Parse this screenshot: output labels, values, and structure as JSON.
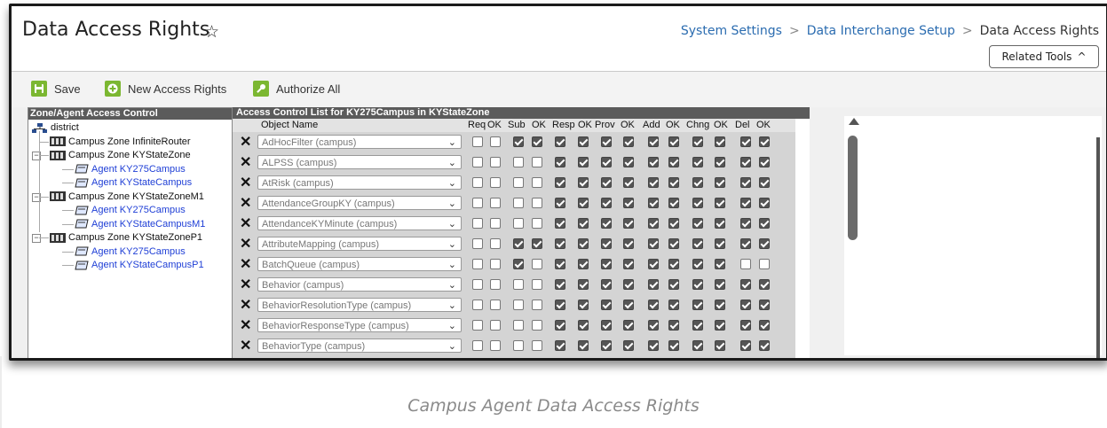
{
  "page": {
    "title": "Data Access Rights",
    "breadcrumb": [
      "System Settings",
      "Data Interchange Setup",
      "Data Access Rights"
    ],
    "related_tools_label": "Related Tools"
  },
  "toolbar": {
    "save_label": "Save",
    "new_label": "New Access Rights",
    "authorize_label": "Authorize All"
  },
  "zone_panel": {
    "title": "Zone/Agent Access Control",
    "nodes": [
      {
        "label": "district",
        "type": "root"
      },
      {
        "label": "Campus Zone InfiniteRouter",
        "type": "zone"
      },
      {
        "label": "Campus Zone KYStateZone",
        "type": "zone"
      },
      {
        "label": "Agent KY275Campus",
        "type": "agent"
      },
      {
        "label": "Agent KYStateCampus",
        "type": "agent"
      },
      {
        "label": "Campus Zone KYStateZoneM1",
        "type": "zone"
      },
      {
        "label": "Agent KY275Campus",
        "type": "agent"
      },
      {
        "label": "Agent KYStateCampusM1",
        "type": "agent"
      },
      {
        "label": "Campus Zone KYStateZoneP1",
        "type": "zone"
      },
      {
        "label": "Agent KY275Campus",
        "type": "agent"
      },
      {
        "label": "Agent KYStateCampusP1",
        "type": "agent"
      }
    ]
  },
  "acl": {
    "title": "Access Control List for KY275Campus in KYStateZone",
    "object_col": "Object Name",
    "columns": [
      "Req",
      "OK",
      "Sub",
      "OK",
      "Resp",
      "OK",
      "Prov",
      "OK",
      "Add",
      "OK",
      "Chng",
      "OK",
      "Del",
      "OK"
    ],
    "rows": [
      {
        "name": "AdHocFilter (campus)",
        "checks": [
          0,
          0,
          1,
          1,
          1,
          1,
          1,
          1,
          1,
          1,
          1,
          1,
          1,
          1
        ]
      },
      {
        "name": "ALPSS (campus)",
        "checks": [
          0,
          0,
          0,
          0,
          1,
          1,
          1,
          1,
          1,
          1,
          1,
          1,
          1,
          1
        ]
      },
      {
        "name": "AtRisk (campus)",
        "checks": [
          0,
          0,
          0,
          0,
          1,
          1,
          1,
          1,
          1,
          1,
          1,
          1,
          1,
          1
        ]
      },
      {
        "name": "AttendanceGroupKY (campus)",
        "checks": [
          0,
          0,
          0,
          0,
          1,
          1,
          1,
          1,
          1,
          1,
          1,
          1,
          1,
          1
        ]
      },
      {
        "name": "AttendanceKYMinute (campus)",
        "checks": [
          0,
          0,
          0,
          0,
          1,
          1,
          1,
          1,
          1,
          1,
          1,
          1,
          1,
          1
        ]
      },
      {
        "name": "AttributeMapping (campus)",
        "checks": [
          0,
          0,
          1,
          1,
          1,
          1,
          1,
          1,
          1,
          1,
          1,
          1,
          1,
          1
        ]
      },
      {
        "name": "BatchQueue (campus)",
        "checks": [
          0,
          0,
          1,
          0,
          1,
          1,
          1,
          1,
          1,
          1,
          1,
          1,
          0,
          0
        ]
      },
      {
        "name": "Behavior (campus)",
        "checks": [
          0,
          0,
          0,
          0,
          1,
          1,
          1,
          1,
          1,
          1,
          1,
          1,
          1,
          1
        ]
      },
      {
        "name": "BehaviorResolutionType (campus)",
        "checks": [
          0,
          0,
          0,
          0,
          1,
          1,
          1,
          1,
          1,
          1,
          1,
          1,
          1,
          1
        ]
      },
      {
        "name": "BehaviorResponseType (campus)",
        "checks": [
          0,
          0,
          0,
          0,
          1,
          1,
          1,
          1,
          1,
          1,
          1,
          1,
          1,
          1
        ]
      },
      {
        "name": "BehaviorType (campus)",
        "checks": [
          0,
          0,
          0,
          0,
          1,
          1,
          1,
          1,
          1,
          1,
          1,
          1,
          1,
          1
        ]
      }
    ]
  },
  "caption": "Campus Agent Data Access Rights",
  "colors": {
    "accent_green": "#7bb731",
    "link_blue": "#2b6cb0",
    "agent_blue": "#1f3fd6",
    "panel_header": "#5b5b5b"
  }
}
